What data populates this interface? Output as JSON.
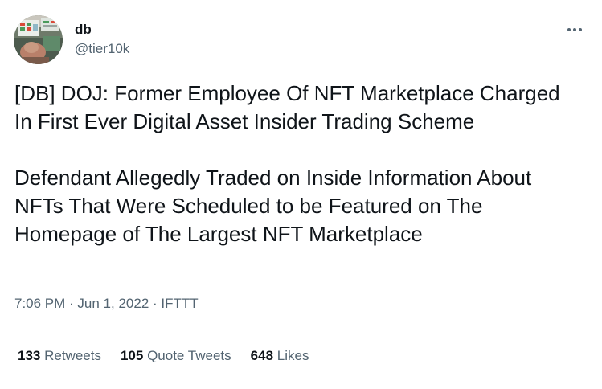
{
  "author": {
    "name": "db",
    "handle": "@tier10k"
  },
  "tweet": {
    "paragraph1": "[DB] DOJ: Former Employee Of NFT Marketplace Charged In First Ever Digital Asset Insider Trading Scheme",
    "paragraph2": "Defendant Allegedly Traded on Inside Information About NFTs That Were Scheduled to be Featured on The Homepage of The Largest NFT Marketplace"
  },
  "meta": {
    "time": "7:06 PM",
    "separator": " · ",
    "date": "Jun 1, 2022",
    "source": "IFTTT"
  },
  "stats": {
    "retweets_count": "133",
    "retweets_label": " Retweets",
    "quotes_count": "105",
    "quotes_label": " Quote Tweets",
    "likes_count": "648",
    "likes_label": " Likes"
  },
  "icons": {
    "more": "more-horizontal-icon"
  },
  "colors": {
    "text_primary": "#0f1419",
    "text_secondary": "#536471",
    "divider": "#eff3f4"
  }
}
